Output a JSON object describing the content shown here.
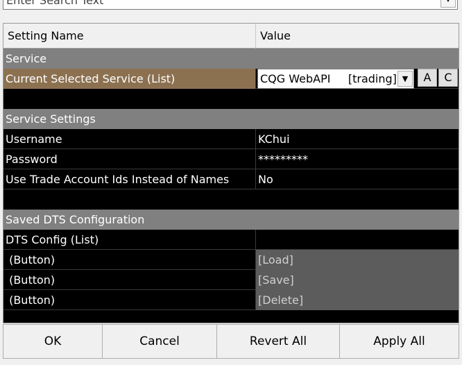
{
  "search": {
    "placeholder": "Enter Search Text"
  },
  "grid": {
    "headers": {
      "name": "Setting Name",
      "value": "Value"
    },
    "service_section": "Service",
    "current_service": {
      "name": "Current Selected Service (List)",
      "value": "CQG WebAPI     [trading]",
      "btn_a": "A",
      "btn_c": "C"
    },
    "service_settings_section": "Service Settings",
    "username": {
      "name": "Username",
      "value": "KChui"
    },
    "password": {
      "name": "Password",
      "value": "*********"
    },
    "use_ids": {
      "name": "Use Trade Account Ids Instead of Names",
      "value": "No"
    },
    "saved_dts_section": "Saved DTS Configuration",
    "dts_config": {
      "name": "DTS Config (List)",
      "value": ""
    },
    "load": {
      "name": " (Button)",
      "value": "[Load]"
    },
    "save": {
      "name": " (Button)",
      "value": "[Save]"
    },
    "delete": {
      "name": " (Button)",
      "value": "[Delete]"
    }
  },
  "footer": {
    "ok": "OK",
    "cancel": "Cancel",
    "revert_all": "Revert All",
    "apply_all": "Apply All"
  },
  "colors": {
    "selected_row": "#8c7151",
    "section_bg": "#808080",
    "grid_bg": "#000000",
    "button_value_bg": "#5c5c5c"
  },
  "icons": {
    "dropdown": "chevron-down-icon"
  }
}
